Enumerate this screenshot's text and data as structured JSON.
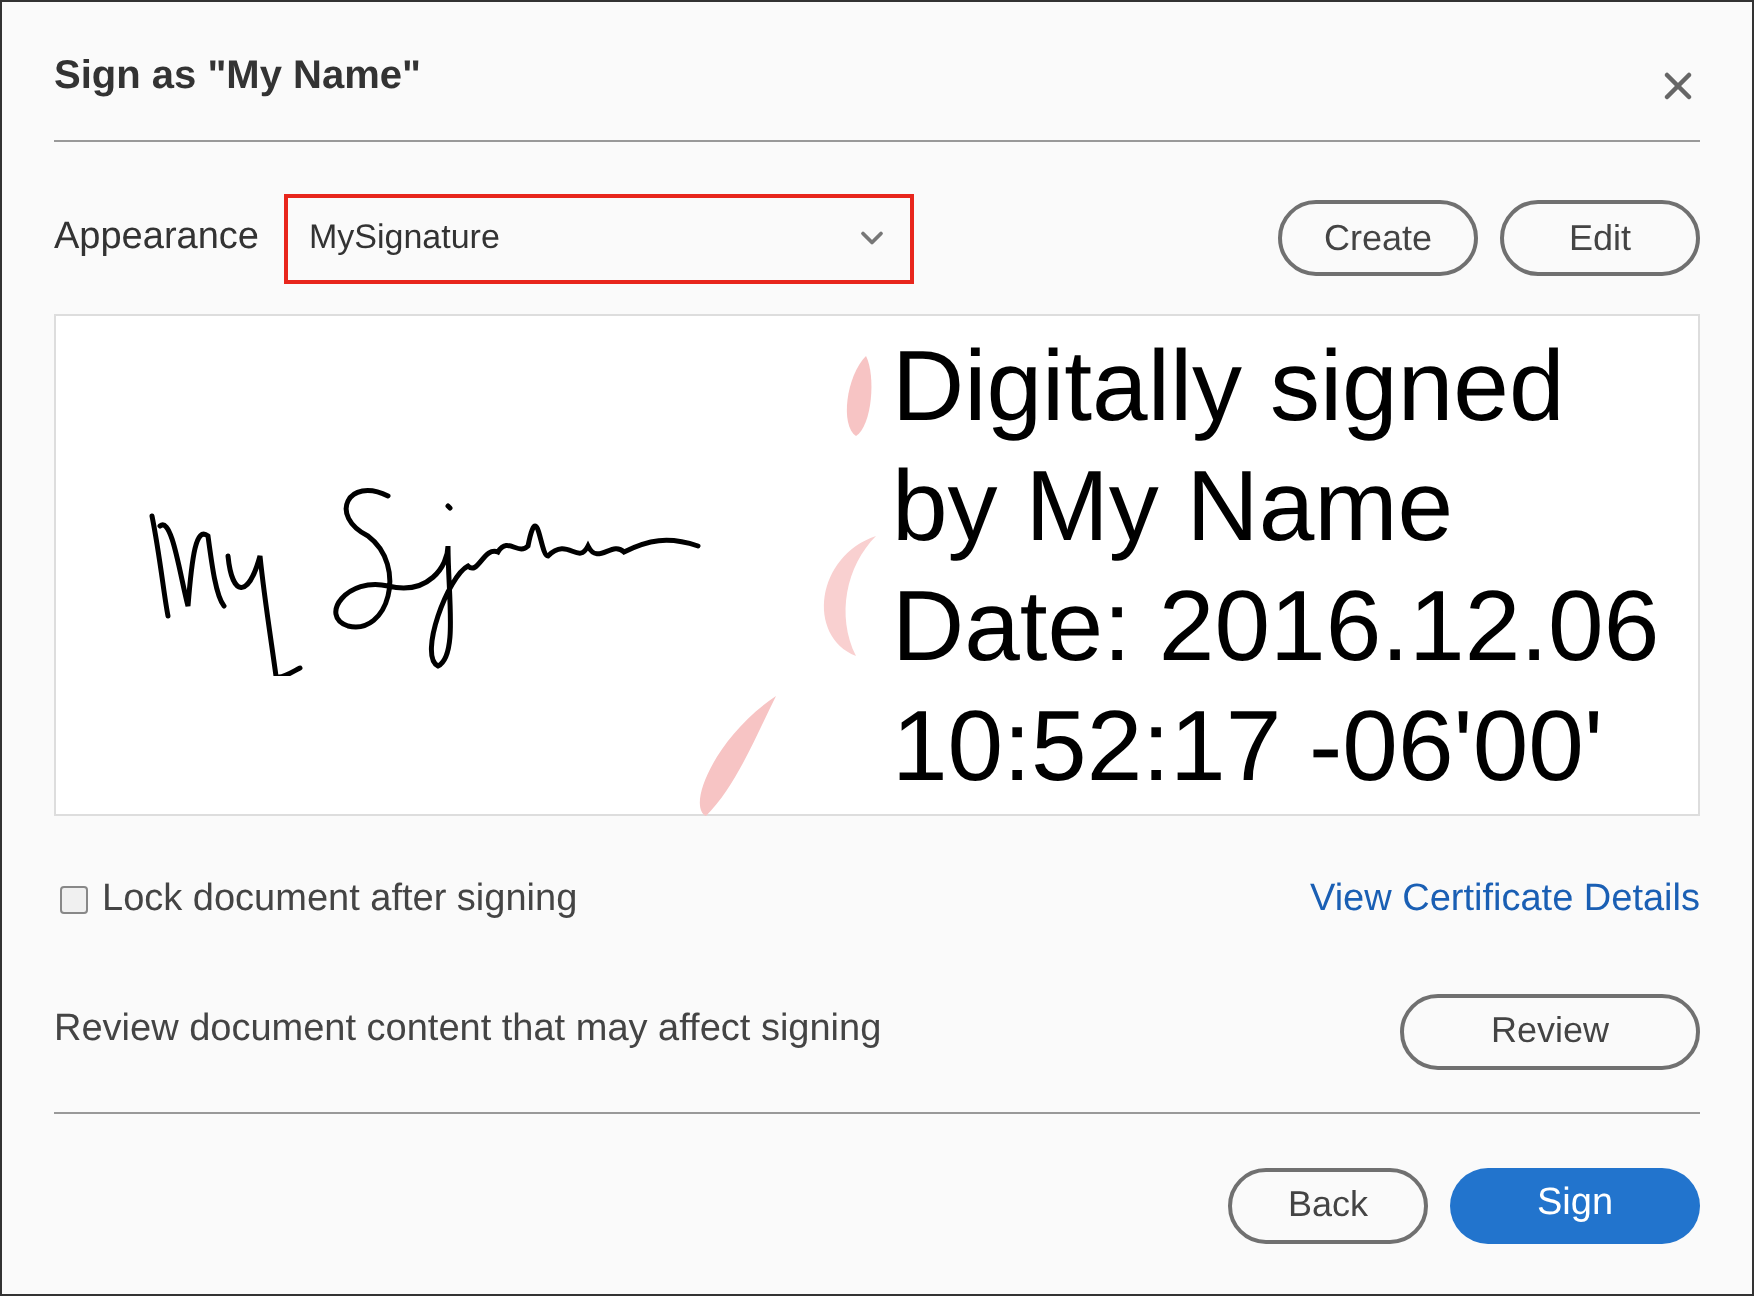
{
  "dialog": {
    "title": "Sign as \"My Name\""
  },
  "appearance": {
    "label": "Appearance",
    "value": "MySignature",
    "actions": [
      "Create",
      "Edit"
    ]
  },
  "signature_preview": {
    "lines": [
      "Digitally signed",
      "by My Name",
      "Date: 2016.12.06",
      "10:52:17 -06'00'"
    ]
  },
  "lock_option": {
    "label": "Lock document after signing",
    "checked": false
  },
  "certificate_link": "View Certificate Details",
  "review": {
    "text": "Review document content that may affect signing",
    "button": "Review"
  },
  "footer_buttons": [
    {
      "label": "Back",
      "primary": false
    },
    {
      "label": "Sign",
      "primary": true
    }
  ]
}
